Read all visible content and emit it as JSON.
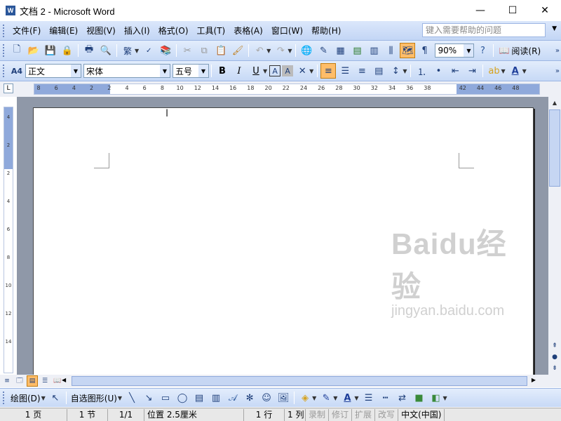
{
  "window": {
    "app_icon": "W",
    "title": "文档 2 - Microsoft Word",
    "minimize": "—",
    "maximize": "☐",
    "close": "✕"
  },
  "menu": {
    "items": [
      {
        "label": "文件(F)"
      },
      {
        "label": "编辑(E)"
      },
      {
        "label": "视图(V)"
      },
      {
        "label": "插入(I)"
      },
      {
        "label": "格式(O)"
      },
      {
        "label": "工具(T)"
      },
      {
        "label": "表格(A)"
      },
      {
        "label": "窗口(W)"
      },
      {
        "label": "帮助(H)"
      }
    ],
    "help_placeholder": "键入需要帮助的问题"
  },
  "standard_toolbar": {
    "zoom": "90%",
    "read_label": "阅读(R)"
  },
  "formatting_toolbar": {
    "style": "正文",
    "font": "宋体",
    "size": "五号",
    "bold": "B",
    "italic": "I",
    "underline": "U"
  },
  "ruler": {
    "h_ticks": [
      "8",
      "6",
      "4",
      "2",
      "2",
      "4",
      "6",
      "8",
      "10",
      "12",
      "14",
      "16",
      "18",
      "20",
      "22",
      "24",
      "26",
      "28",
      "30",
      "32",
      "34",
      "36",
      "38",
      "42",
      "44",
      "46",
      "48"
    ],
    "v_ticks": [
      "4",
      "2",
      "2",
      "4",
      "6",
      "8",
      "10",
      "12",
      "14"
    ]
  },
  "watermark": {
    "main": "Baidu经验",
    "sub": "jingyan.baidu.com"
  },
  "drawing_toolbar": {
    "draw_label": "绘图(D)",
    "autoshapes_label": "自选图形(U)"
  },
  "status": {
    "page": "1 页",
    "section": "1 节",
    "page_of": "1/1",
    "position": "位置 2.5厘米",
    "line": "1 行",
    "column": "1 列",
    "rec": "录制",
    "trk": "修订",
    "ext": "扩展",
    "ovr": "改写",
    "language": "中文(中国)"
  }
}
